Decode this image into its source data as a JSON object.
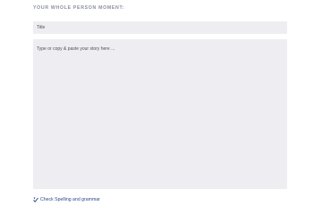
{
  "section": {
    "heading": "YOUR WHOLE PERSON MOMENT:"
  },
  "form": {
    "title_placeholder": "Title",
    "title_value": "",
    "story_placeholder": "Type or copy & paste your story here ...",
    "story_value": ""
  },
  "spell_check": {
    "icon": "spellcheck-icon",
    "label": "Check Spelling and grammar",
    "color": "#2a4a8a"
  },
  "colors": {
    "field_background": "#eeedf2",
    "heading_text": "#8a8f99",
    "page_background": "#ffffff"
  }
}
